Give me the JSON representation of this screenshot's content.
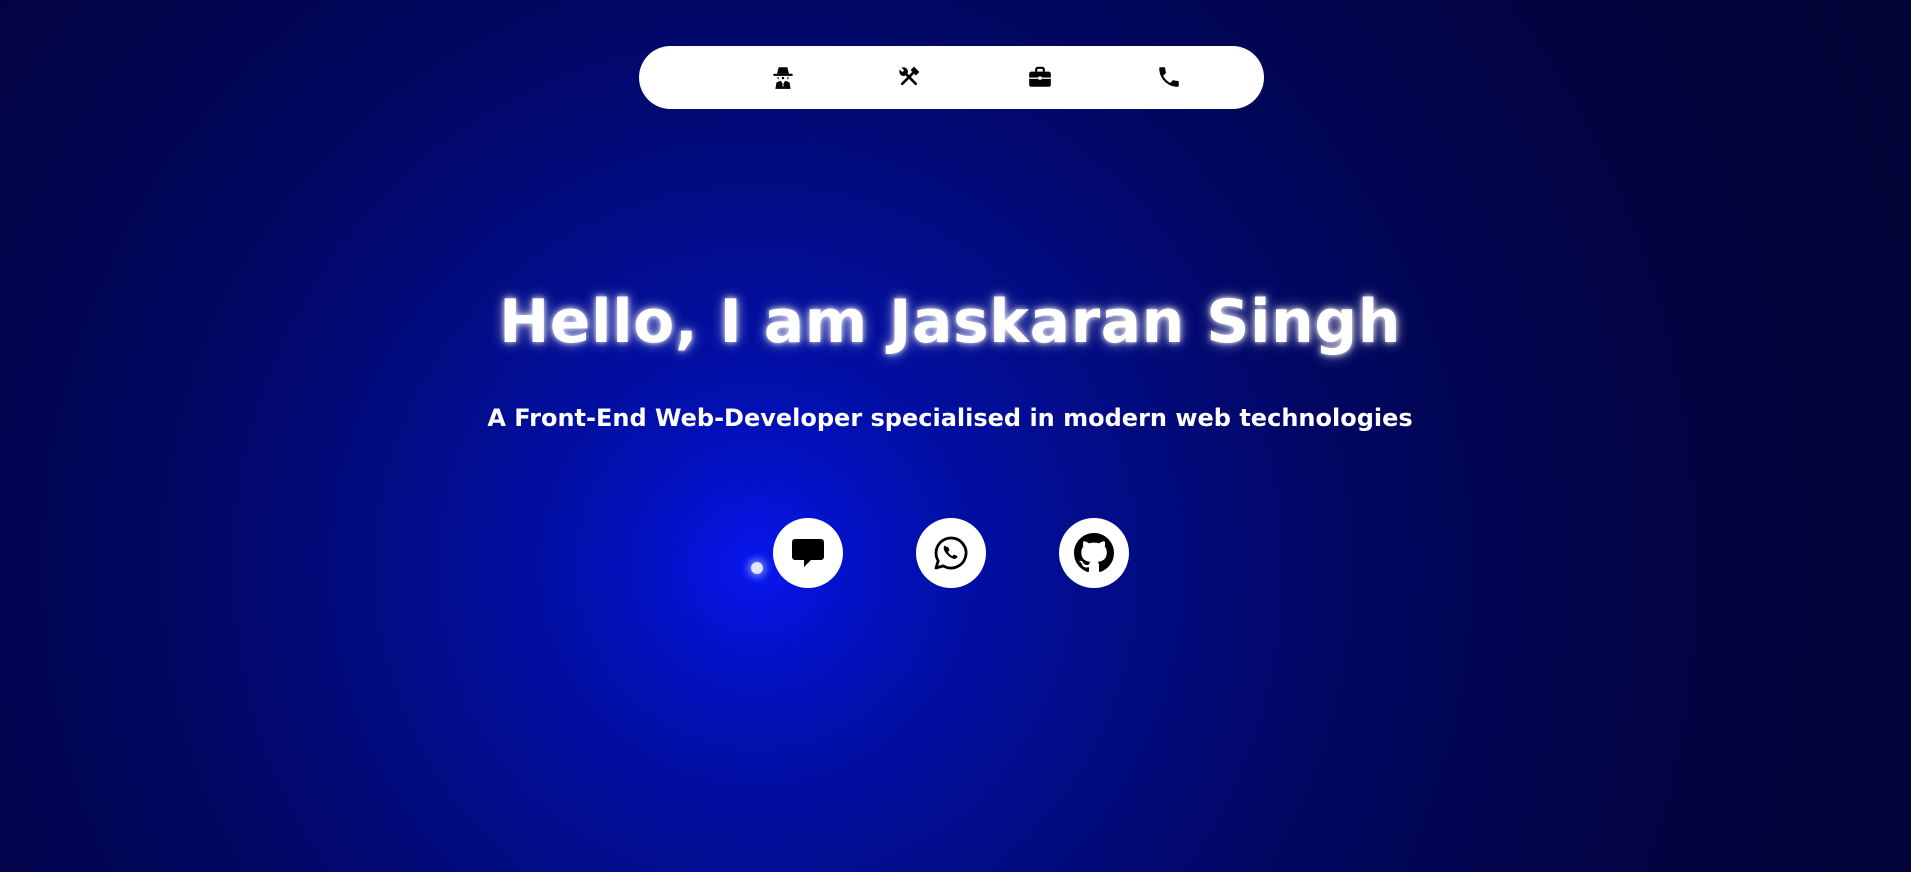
{
  "nav": {
    "items": [
      {
        "icon": "user-secret-icon"
      },
      {
        "icon": "tools-icon"
      },
      {
        "icon": "briefcase-icon"
      },
      {
        "icon": "phone-icon"
      }
    ]
  },
  "hero": {
    "title": "Hello, I am Jaskaran Singh",
    "subtitle": "A Front-End Web-Developer specialised in modern web technologies"
  },
  "social": {
    "links": [
      {
        "icon": "message-icon"
      },
      {
        "icon": "whatsapp-icon"
      },
      {
        "icon": "github-icon"
      }
    ]
  },
  "colors": {
    "background_glow": "#0a16f0",
    "background_edge": "#020335",
    "nav_background": "#ffffff",
    "text": "#ffffff",
    "icon": "#000000"
  }
}
